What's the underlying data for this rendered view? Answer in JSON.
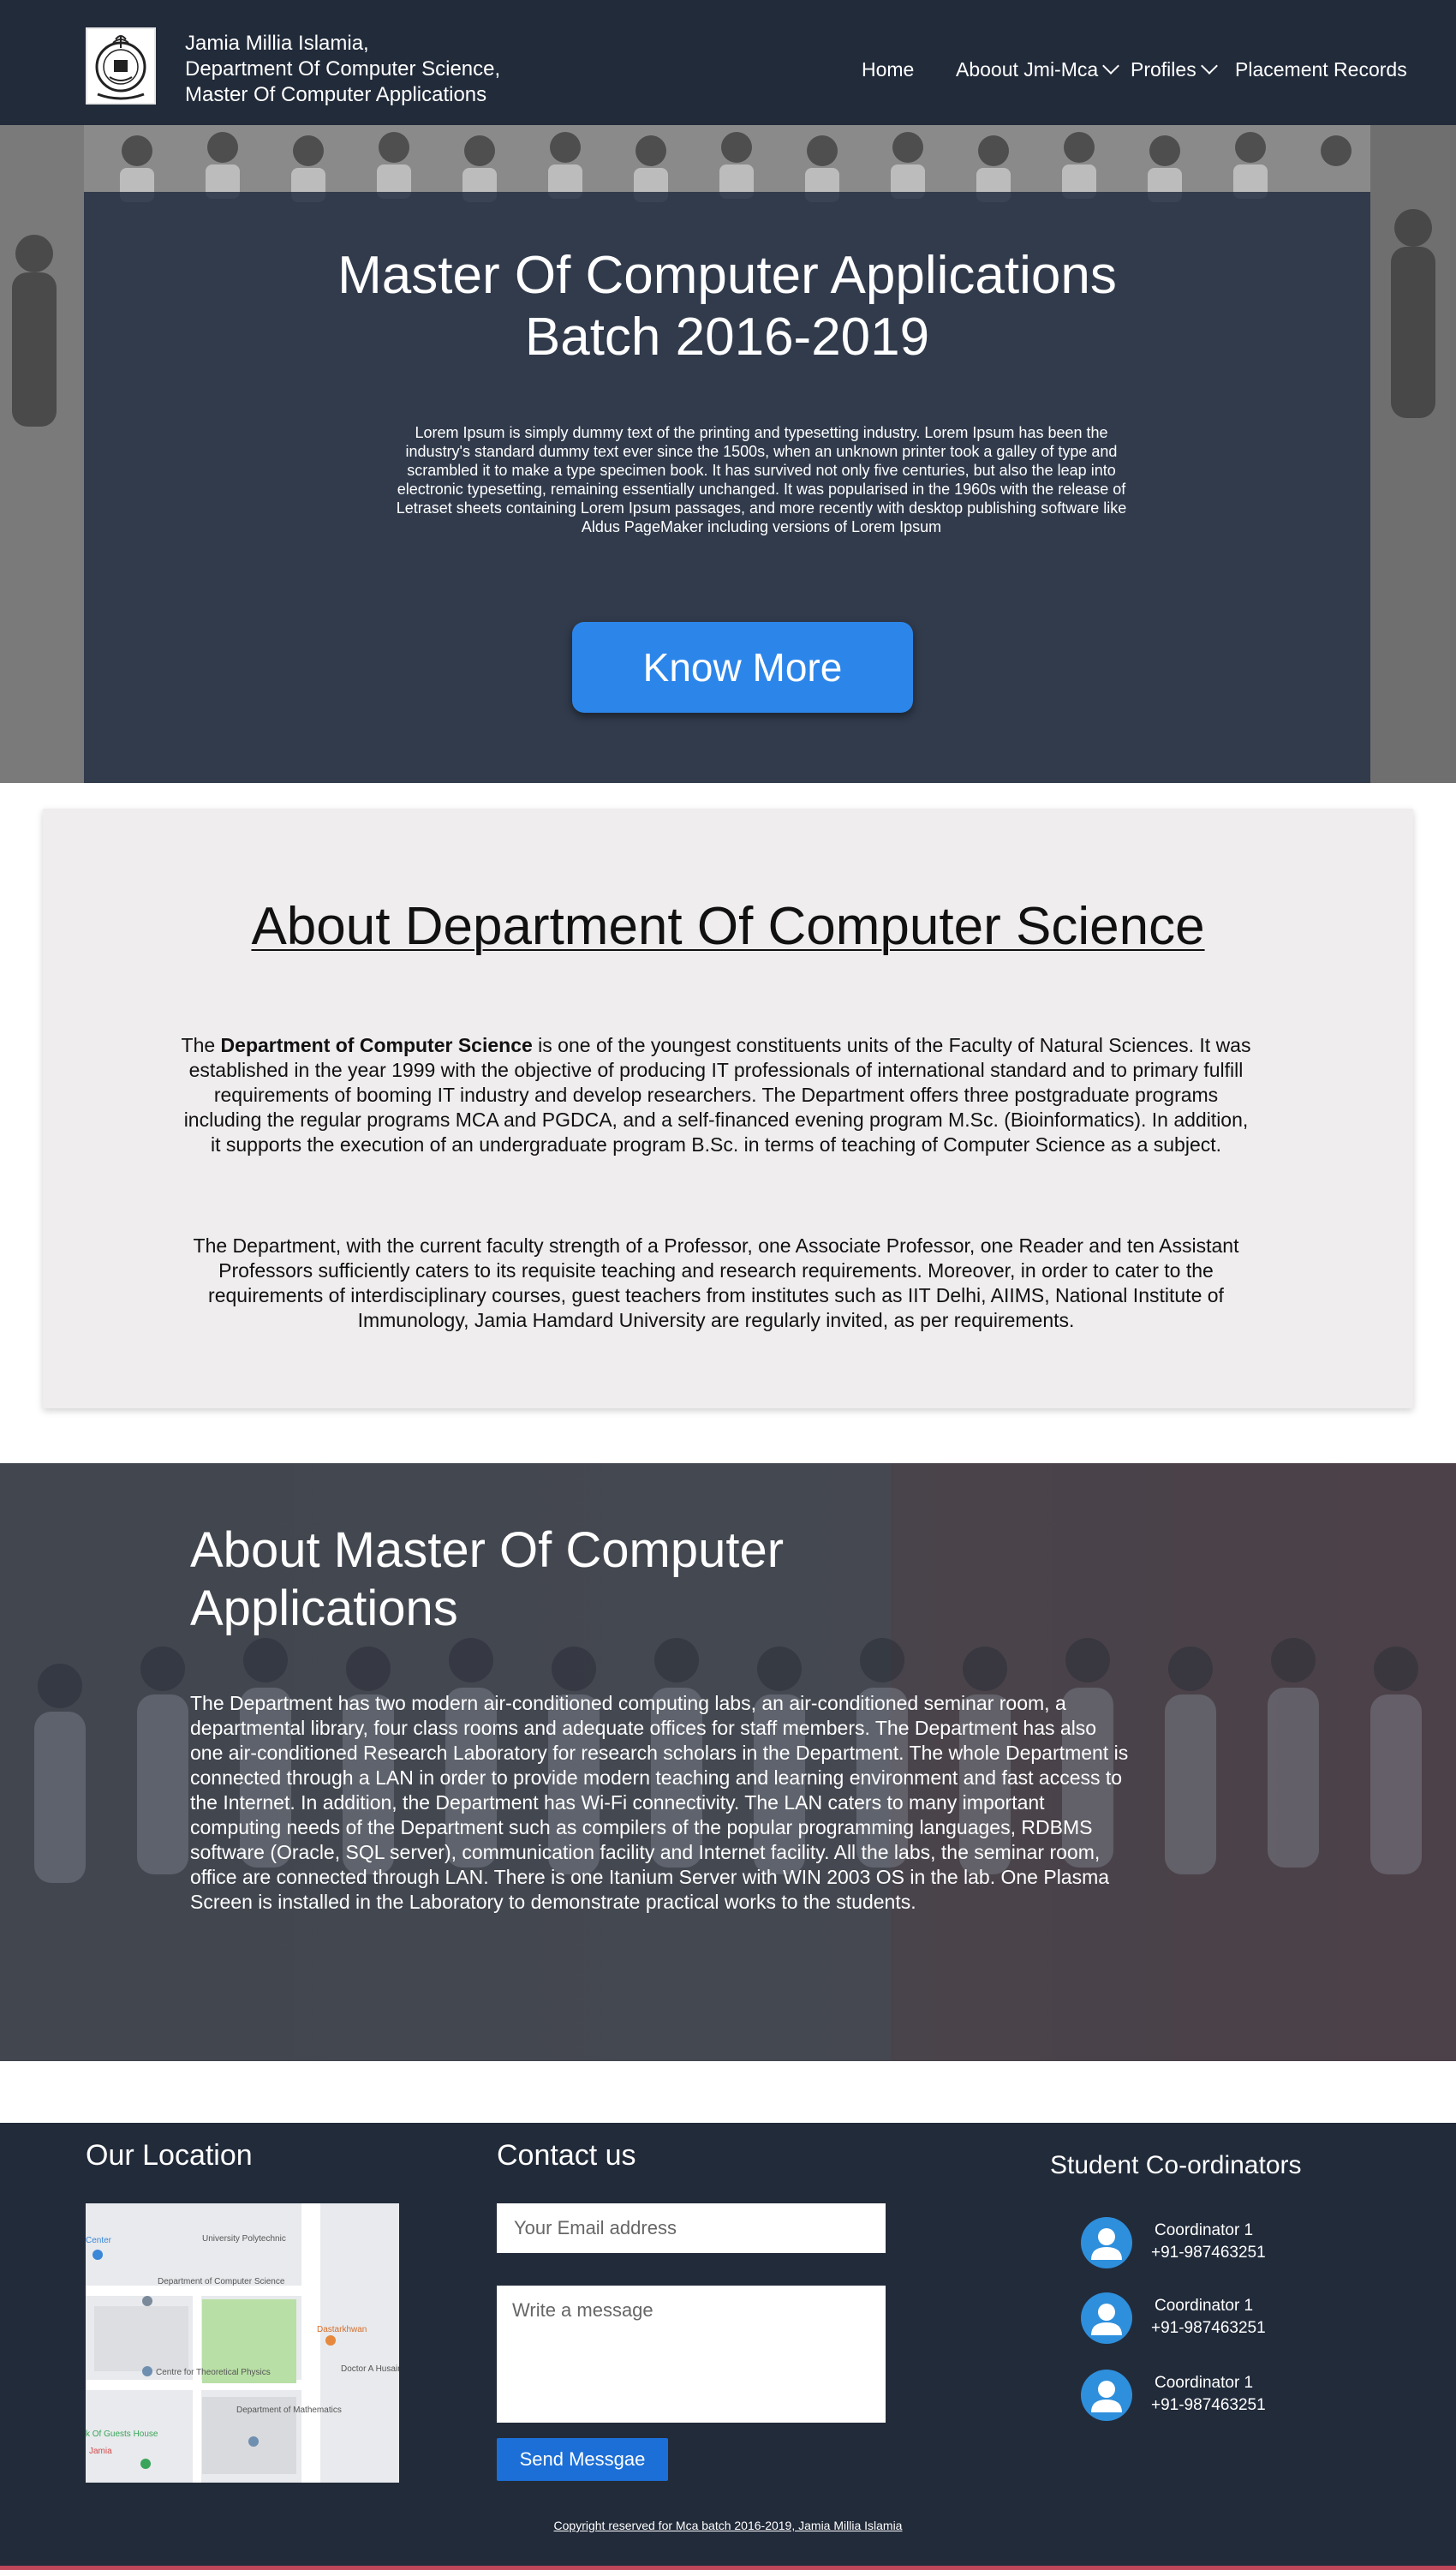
{
  "header": {
    "brand_lines": [
      "Jamia Millia Islamia,",
      "Department Of Computer Science,",
      "Master Of Computer Applications"
    ],
    "nav": [
      {
        "label": "Home",
        "has_dropdown": false
      },
      {
        "label": "Aboout Jmi-Mca",
        "has_dropdown": true
      },
      {
        "label": "Profiles",
        "has_dropdown": true
      },
      {
        "label": "Placement Records",
        "has_dropdown": false
      }
    ],
    "logo_icon": "university-seal-icon",
    "colors": {
      "background": "#222b3a",
      "text": "#ffffff"
    }
  },
  "hero": {
    "title_line1": "Master Of Computer Applications",
    "title_line2": "Batch 2016-2019",
    "text": "Lorem Ipsum is simply dummy text of the printing and typesetting industry. Lorem Ipsum has been the industry's standard dummy text ever since the 1500s, when an unknown printer took a galley of type and scrambled it to make a type specimen book. It has survived not only five centuries, but also the leap into electronic typesetting, remaining essentially unchanged. It was popularised in the 1960s with the release of Letraset sheets containing Lorem Ipsum passages, and more recently with desktop publishing software like Aldus PageMaker including versions of Lorem Ipsum",
    "button_label": "Know More",
    "colors": {
      "button": "#2c86ea",
      "overlay": "#232e42"
    }
  },
  "about_department": {
    "heading": "About Department Of Computer Science",
    "p1_prefix": "The ",
    "p1_bold": "Department of Computer Science",
    "p1_rest": " is one of the youngest constituents units of the Faculty of Natural Sciences. It was established in the year 1999 with the objective of producing IT professionals of international standard and to primary fulfill requirements of booming IT industry and develop researchers. The Department offers three postgraduate programs including the regular programs MCA and PGDCA, and a self-financed evening program M.Sc. (Bioinformatics). In addition, it supports the execution of an undergraduate program B.Sc. in terms of teaching of Computer Science as a subject.",
    "p2": "The Department, with the current faculty strength of a Professor, one Associate Professor, one Reader and ten Assistant Professors sufficiently caters to its requisite teaching and research requirements. Moreover, in order to cater to the requirements of interdisciplinary courses, guest teachers from institutes such as IIT Delhi, AIIMS, National Institute of Immunology, Jamia Hamdard University are regularly invited, as per requirements."
  },
  "about_mca": {
    "heading": "About Master Of Computer Applications",
    "text": "The Department has two modern air-conditioned computing labs, an air-conditioned seminar room, a  departmental library, four class rooms and adequate offices for staff members. The Department has also one air-conditioned Research Laboratory for research scholars in the Department. The whole Department is connected through a LAN in order to provide modern teaching and learning environment and fast access to the Internet. In addition, the Department has Wi-Fi connectivity. The LAN caters to many important computing needs of the Department such as compilers of the popular programming languages, RDBMS software (Oracle, SQL server), communication facility and Internet facility. All the labs, the seminar room, office are connected through LAN. There is one Itanium Server with WIN 2003 OS in the lab. One Plasma Screen is installed in the Laboratory to demonstrate practical works to the students."
  },
  "footer": {
    "location_heading": "Our Location",
    "map_labels": [
      "University Polytechnic",
      "Department of Computer Science",
      "Centre for Theoretical Physics",
      "Department of Mathematics",
      "Dastarkhwan",
      "Doctor A Husain Lib",
      "Center",
      "k Of Guests House",
      "Jamia"
    ],
    "contact_heading": "Contact us",
    "email_placeholder": "Your Email address",
    "message_placeholder": "Write a message",
    "send_label": "Send Messgae",
    "coordinators_heading": "Student Co-ordinators",
    "coordinators": [
      {
        "name": "Coordinator 1",
        "phone": "+91-987463251"
      },
      {
        "name": "Coordinator 1",
        "phone": "+91-987463251"
      },
      {
        "name": "Coordinator 1",
        "phone": "+91-987463251"
      }
    ],
    "copyright": "Copyright reserved for Mca batch 2016-2019, Jamia Millia Islamia",
    "colors": {
      "background": "#222b3a",
      "send_button": "#1c6fd6",
      "avatar": "#2e8fdc",
      "bottom_line": "#c0465a"
    }
  }
}
